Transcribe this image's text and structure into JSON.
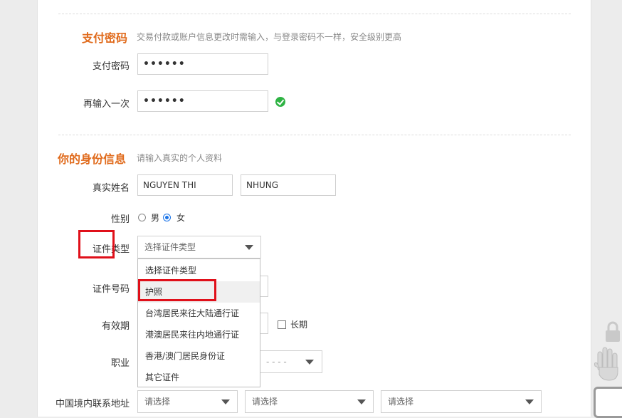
{
  "payment_section": {
    "title": "支付密码",
    "hint": "交易付款或账户信息更改时需输入，与登录密码不一样，安全级别更高",
    "password_label": "支付密码",
    "password_value": "••••••",
    "confirm_label": "再输入一次",
    "confirm_value": "••••••"
  },
  "identity_section": {
    "title": "你的身份信息",
    "hint": "请输入真实的个人资料",
    "name_label": "真实姓名",
    "surname_value": "NGUYEN THI",
    "given_name_value": "NHUNG",
    "gender_label": "性别",
    "gender_male": "男",
    "gender_female": "女",
    "gender_selected": "女",
    "id_type_label": "证件类型",
    "id_type_selected": "选择证件类型",
    "id_type_options": [
      "选择证件类型",
      "护照",
      "台湾居民来往大陆通行证",
      "港澳居民来往内地通行证",
      "香港/澳门居民身份证",
      "其它证件"
    ],
    "id_number_label": "证件号码",
    "validity_label": "有效期",
    "long_term_label": "长期",
    "occupation_label": "职业",
    "occupation_placeholder": "- - - -",
    "address_label": "中国境内联系地址",
    "address_selects": [
      "请选择",
      "请选择",
      "请选择"
    ]
  },
  "colors": {
    "section_title": "#e06a1b",
    "highlight_box": "#e0101a",
    "ok": "#2fb344",
    "radio": "#1a73e8"
  }
}
